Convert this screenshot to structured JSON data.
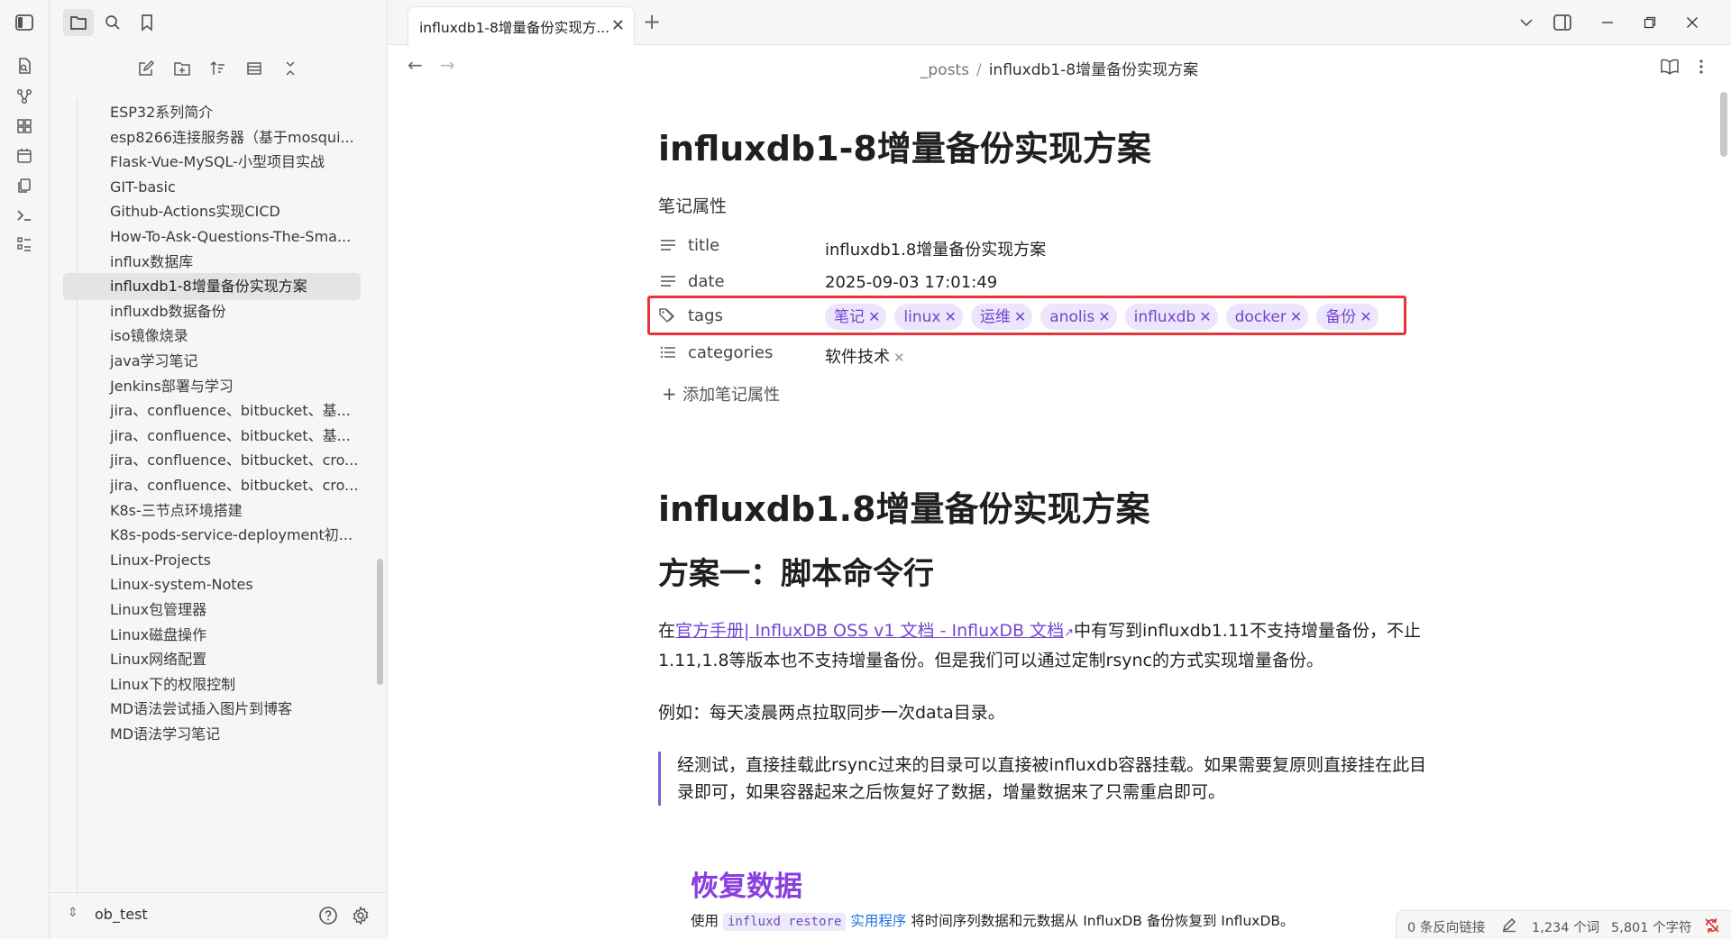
{
  "sidebar": {
    "vault_name": "ob_test",
    "files": [
      "ESP32系列简介",
      "esp8266连接服务器（基于mosqui...",
      "Flask-Vue-MySQL-小型项目实战",
      "GIT-basic",
      "Github-Actions实现CICD",
      "How-To-Ask-Questions-The-Sma...",
      "influx数据库",
      "influxdb1-8增量备份实现方案",
      "influxdb数据备份",
      "iso镜像烧录",
      "java学习笔记",
      "Jenkins部署与学习",
      "jira、confluence、bitbucket、基...",
      "jira、confluence、bitbucket、基...",
      "jira、confluence、bitbucket、cro...",
      "jira、confluence、bitbucket、cro...",
      "K8s-三节点环境搭建",
      "K8s-pods-service-deployment初...",
      "Linux-Projects",
      "Linux-system-Notes",
      "Linux包管理器",
      "Linux磁盘操作",
      "Linux网络配置",
      "Linux下的权限控制",
      "MD语法尝试插入图片到博客",
      "MD语法学习笔记"
    ],
    "active_index": 7
  },
  "tab": {
    "title": "influxdb1-8增量备份实现方..."
  },
  "breadcrumb": {
    "folder": "_posts",
    "separator": "/",
    "file": "influxdb1-8增量备份实现方案"
  },
  "note": {
    "inline_title": "influxdb1-8增量备份实现方案",
    "properties_heading": "笔记属性",
    "properties": {
      "title_key": "title",
      "title_value": "influxdb1.8增量备份实现方案",
      "date_key": "date",
      "date_value": "2025-09-03 17:01:49",
      "tags_key": "tags",
      "tags": [
        "笔记",
        "linux",
        "运维",
        "anolis",
        "influxdb",
        "docker",
        "备份"
      ],
      "categories_key": "categories",
      "categories_value": "软件技术"
    },
    "add_property": "添加笔记属性",
    "h1": "influxdb1.8增量备份实现方案",
    "h2": "方案一：脚本命令行",
    "p1_pre": "在",
    "p1_link": "官方手册| InfluxDB OSS v1 文档 - InfluxDB 文档",
    "p1_post": "中有写到influxdb1.11不支持增量备份，不止1.11,1.8等版本也不支持增量备份。但是我们可以通过定制rsync的方式实现增量备份。",
    "p2": "例如：每天凌晨两点拉取同步一次data目录。",
    "quote": "经测试，直接挂载此rsync过来的目录可以直接被influxdb容器挂载。如果需要复原则直接挂在此目录即可，如果容器起来之后恢复好了数据，增量数据来了只需重启即可。",
    "embed_title": "恢复数据",
    "embed_pre": "使用",
    "embed_code": "influxd restore",
    "embed_link": "实用程序",
    "embed_post": "将时间序列数据和元数据从 InfluxDB 备份恢复到 InfluxDB。"
  },
  "status": {
    "backlinks": "0 条反向链接",
    "words": "1,234 个词",
    "chars": "5,801 个字符"
  }
}
